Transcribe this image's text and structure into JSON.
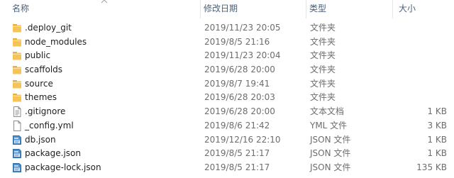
{
  "columns": {
    "name": "名称",
    "date": "修改日期",
    "type": "类型",
    "size": "大小"
  },
  "sort": {
    "column": "name",
    "direction": "ascending",
    "icon": "sort-up-chevron-icon"
  },
  "colors": {
    "header_text": "#4c607a",
    "secondary_text": "#6d6d6d",
    "folder_yellow": "#f4c45a",
    "hover_bg": "#e5f3ff"
  },
  "files": [
    {
      "name": ".deploy_git",
      "date": "2019/11/23 20:05",
      "type": "文件夹",
      "size": "",
      "icon": "folder-icon"
    },
    {
      "name": "node_modules",
      "date": "2019/8/5 21:16",
      "type": "文件夹",
      "size": "",
      "icon": "folder-icon"
    },
    {
      "name": "public",
      "date": "2019/11/23 20:04",
      "type": "文件夹",
      "size": "",
      "icon": "folder-icon"
    },
    {
      "name": "scaffolds",
      "date": "2019/6/28 20:00",
      "type": "文件夹",
      "size": "",
      "icon": "folder-icon"
    },
    {
      "name": "source",
      "date": "2019/8/7 19:41",
      "type": "文件夹",
      "size": "",
      "icon": "folder-icon"
    },
    {
      "name": "themes",
      "date": "2019/6/28 20:03",
      "type": "文件夹",
      "size": "",
      "icon": "folder-icon"
    },
    {
      "name": ".gitignore",
      "date": "2019/6/28 20:00",
      "type": "文本文档",
      "size": "1 KB",
      "icon": "text-document-icon"
    },
    {
      "name": "_config.yml",
      "date": "2019/8/6 21:42",
      "type": "YML 文件",
      "size": "3 KB",
      "icon": "blank-file-icon"
    },
    {
      "name": "db.json",
      "date": "2019/12/16 22:10",
      "type": "JSON 文件",
      "size": "1 KB",
      "icon": "json-file-icon"
    },
    {
      "name": "package.json",
      "date": "2019/8/5 21:17",
      "type": "JSON 文件",
      "size": "1 KB",
      "icon": "json-file-icon"
    },
    {
      "name": "package-lock.json",
      "date": "2019/8/5 21:17",
      "type": "JSON 文件",
      "size": "135 KB",
      "icon": "json-file-icon"
    }
  ]
}
